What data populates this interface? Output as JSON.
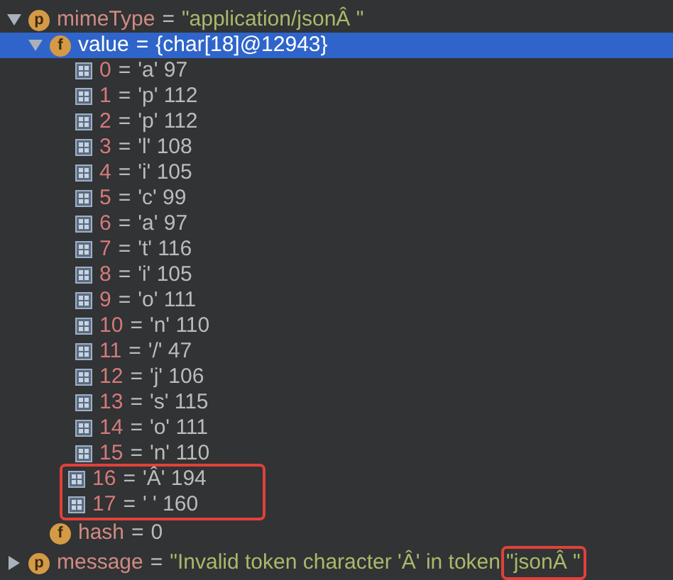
{
  "tree": [
    {
      "name": "mimeType",
      "badge": "p",
      "op": "=",
      "value": "\"application/jsonÂ \"",
      "kind": "string",
      "expanded": true,
      "selected": false,
      "children": [
        {
          "name": "value",
          "badge": "f",
          "op": "=",
          "value": "{char[18]@12943}",
          "kind": "object",
          "expanded": true,
          "selected": true,
          "children": [
            {
              "index": "0",
              "op": "=",
              "value": "'a' 97",
              "highlighted": false
            },
            {
              "index": "1",
              "op": "=",
              "value": "'p' 112",
              "highlighted": false
            },
            {
              "index": "2",
              "op": "=",
              "value": "'p' 112",
              "highlighted": false
            },
            {
              "index": "3",
              "op": "=",
              "value": "'l' 108",
              "highlighted": false
            },
            {
              "index": "4",
              "op": "=",
              "value": "'i' 105",
              "highlighted": false
            },
            {
              "index": "5",
              "op": "=",
              "value": "'c' 99",
              "highlighted": false
            },
            {
              "index": "6",
              "op": "=",
              "value": "'a' 97",
              "highlighted": false
            },
            {
              "index": "7",
              "op": "=",
              "value": "'t' 116",
              "highlighted": false
            },
            {
              "index": "8",
              "op": "=",
              "value": "'i' 105",
              "highlighted": false
            },
            {
              "index": "9",
              "op": "=",
              "value": "'o' 111",
              "highlighted": false
            },
            {
              "index": "10",
              "op": "=",
              "value": "'n' 110",
              "highlighted": false
            },
            {
              "index": "11",
              "op": "=",
              "value": "'/' 47",
              "highlighted": false
            },
            {
              "index": "12",
              "op": "=",
              "value": "'j' 106",
              "highlighted": false
            },
            {
              "index": "13",
              "op": "=",
              "value": "'s' 115",
              "highlighted": false
            },
            {
              "index": "14",
              "op": "=",
              "value": "'o' 111",
              "highlighted": false
            },
            {
              "index": "15",
              "op": "=",
              "value": "'n' 110",
              "highlighted": false
            },
            {
              "index": "16",
              "op": "=",
              "value": "'Â' 194",
              "highlighted": true
            },
            {
              "index": "17",
              "op": "=",
              "value": "' ' 160",
              "highlighted": true
            }
          ]
        },
        {
          "name": "hash",
          "badge": "f",
          "op": "=",
          "value": "0",
          "kind": "number",
          "selected": false
        }
      ]
    },
    {
      "name": "message",
      "badge": "p",
      "op": "=",
      "value": "\"Invalid token character 'Â' in token ",
      "value_highlighted": "\"jsonÂ \"",
      "kind": "string",
      "expanded": false,
      "selected": false
    }
  ]
}
